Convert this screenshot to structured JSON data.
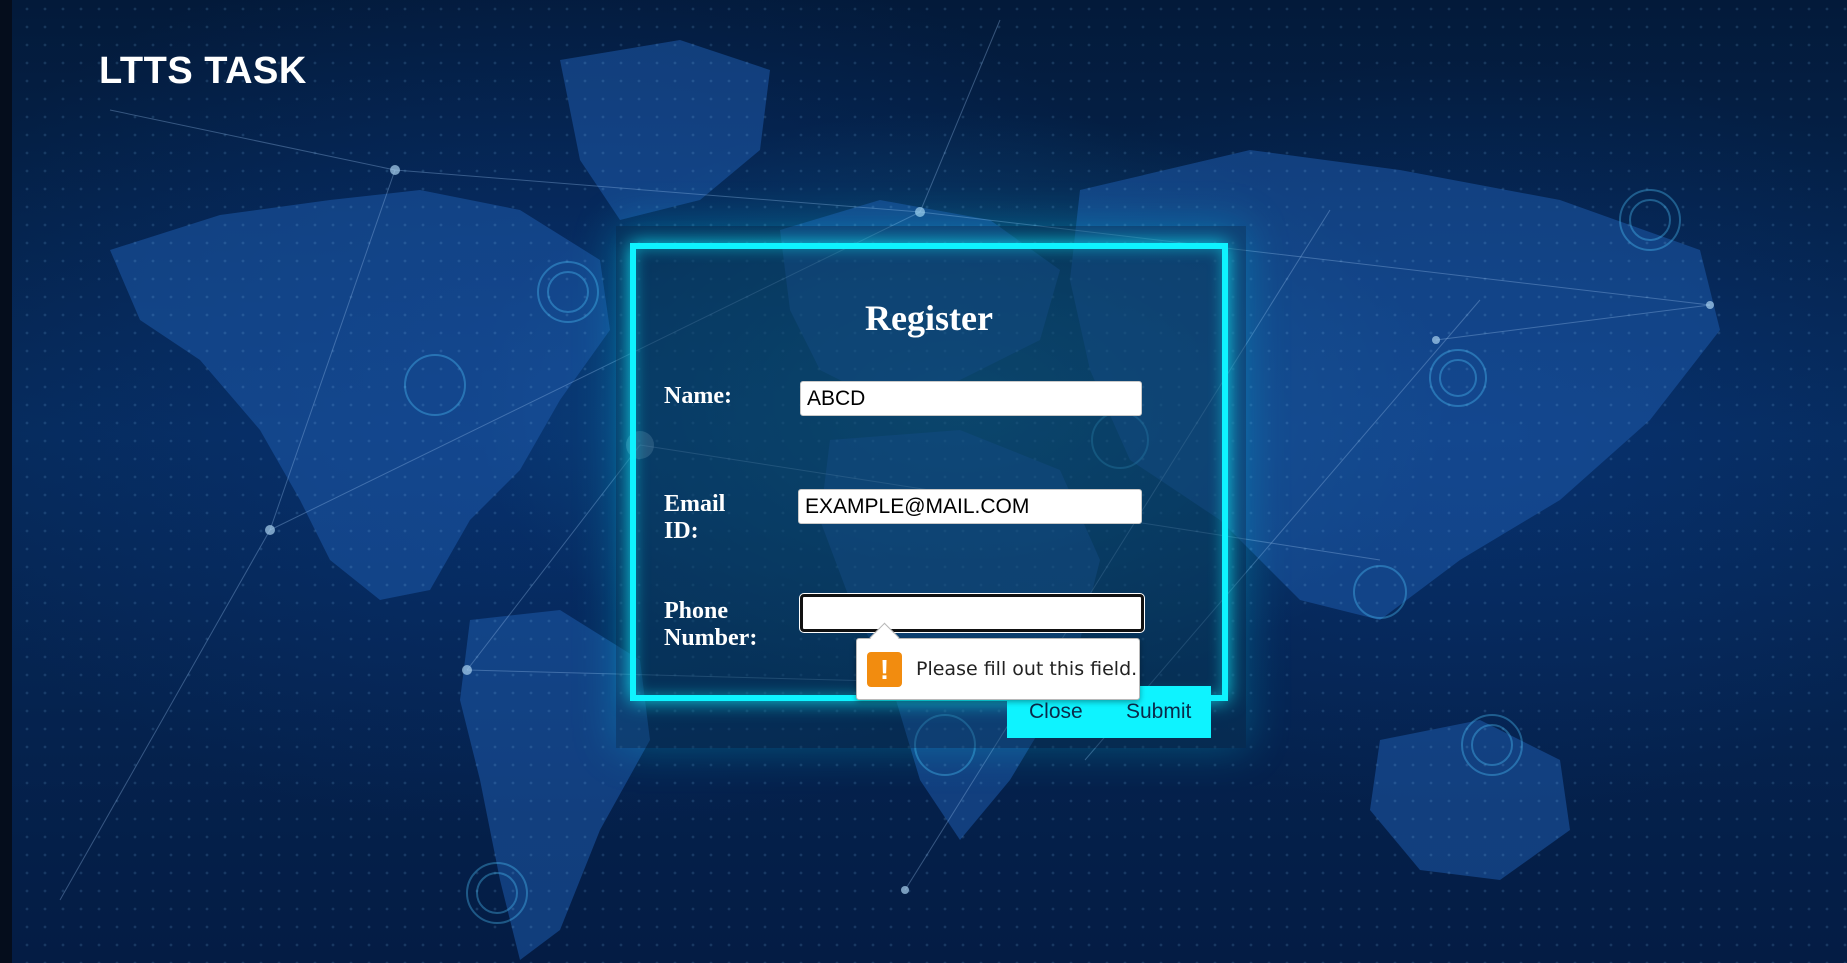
{
  "app": {
    "brand_title": "LTTS TASK"
  },
  "modal": {
    "title": "Register",
    "fields": {
      "name": {
        "label": "Name:",
        "value": "ABCD",
        "placeholder": ""
      },
      "email": {
        "label_line1": "Email",
        "label_line2": "ID:",
        "value": "EXAMPLE@MAIL.COM",
        "placeholder": ""
      },
      "phone": {
        "label_line1": "Phone",
        "label_line2": "Number:",
        "value": "",
        "placeholder": ""
      }
    },
    "buttons": {
      "close_label": "Close",
      "submit_label": "Submit"
    }
  },
  "validation_tooltip": {
    "icon": "warning-exclamation-icon",
    "glyph": "!",
    "message": "Please fill out this field."
  },
  "colors": {
    "accent_cyan": "#0ef3ff",
    "background_navy": "#062a5a",
    "warning_orange": "#f28c0f"
  }
}
